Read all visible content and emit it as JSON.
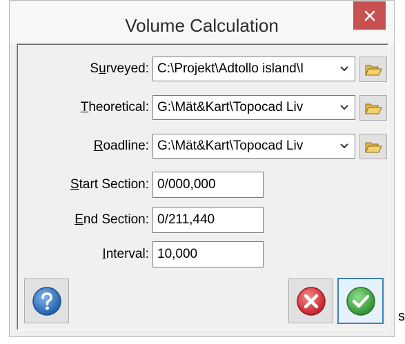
{
  "window": {
    "title": "Volume Calculation",
    "close_icon": "close-icon"
  },
  "background": {
    "partial_text": "s"
  },
  "form": {
    "surveyed": {
      "mnemonic": "u",
      "label_before": "S",
      "label_after": "rveyed:",
      "value": "C:\\Projekt\\Adtollo island\\I",
      "icon": "folder-open-icon"
    },
    "theoretical": {
      "mnemonic": "T",
      "label_before": "",
      "label_after": "heoretical:",
      "value": "G:\\Mät&Kart\\Topocad Liv",
      "icon": "folder-open-icon"
    },
    "roadline": {
      "mnemonic": "R",
      "label_before": "",
      "label_after": "oadline:",
      "value": "G:\\Mät&Kart\\Topocad Liv",
      "icon": "folder-open-icon"
    },
    "start_section": {
      "mnemonic": "S",
      "label_before": "",
      "label_after": "tart Section:",
      "value": "0/000,000"
    },
    "end_section": {
      "mnemonic": "E",
      "label_before": "",
      "label_after": "nd Section:",
      "value": "0/211,440"
    },
    "interval": {
      "mnemonic": "I",
      "label_before": "",
      "label_after": "nterval:",
      "value": "10,000"
    }
  },
  "buttons": {
    "help_icon": "help-icon",
    "cancel_icon": "cancel-icon",
    "ok_icon": "ok-check-icon"
  },
  "colors": {
    "close_bg": "#c75050",
    "help_blue": "#2f6fb5",
    "cancel_red": "#d9343a",
    "ok_green": "#3aa53a",
    "folder_yellow": "#f2d36b"
  }
}
